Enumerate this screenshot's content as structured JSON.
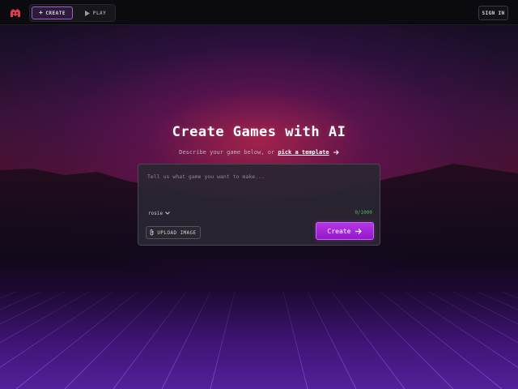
{
  "header": {
    "tabs": [
      {
        "label": "CREATE",
        "icon": "plus-icon",
        "active": true
      },
      {
        "label": "PLAY",
        "icon": "play-icon",
        "active": false
      }
    ],
    "sign_in_label": "SIGN IN"
  },
  "hero": {
    "title": "Create Games with AI",
    "subtitle_prefix": "Describe your game below, or ",
    "template_link": "pick a template",
    "arrow_icon": "arrow-right-icon"
  },
  "prompt": {
    "placeholder": "Tell us what game you want to make...",
    "value": "",
    "model": "rosie",
    "char_count": "0/1000",
    "upload_label": "UPLOAD IMAGE",
    "create_label": "Create"
  },
  "colors": {
    "accent": "#a12fd8",
    "active_tab_border": "#a45ad8",
    "counter": "#4fb45c",
    "background": "#0d0a12"
  }
}
